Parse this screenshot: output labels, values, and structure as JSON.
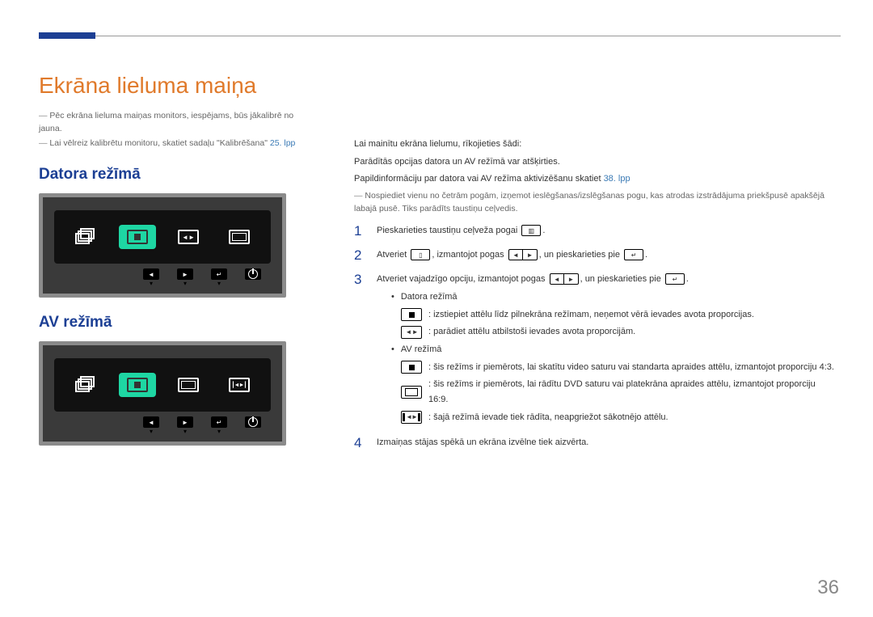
{
  "title": "Ekrāna lieluma maiņa",
  "notes": {
    "n1": "Pēc ekrāna lieluma maiņas monitors, iespējams, būs jākalibrē no jauna.",
    "n2_a": "Lai vēlreiz kalibrētu monitoru, skatiet sadaļu \"Kalibrēšana\" ",
    "n2_link": "25. lpp"
  },
  "left": {
    "h_pc": "Datora režīmā",
    "h_av": "AV režīmā"
  },
  "right": {
    "p1": "Lai mainītu ekrāna lielumu, rīkojieties šādi:",
    "p2": "Parādītās opcijas datora un AV režīmā var atšķirties.",
    "p3_a": "Papildinformāciju par datora vai AV režīma aktivizēšanu skatiet ",
    "p3_link": "38. lpp",
    "note": "Nospiediet vienu no četrām pogām, izņemot ieslēgšanas/izslēgšanas pogu, kas atrodas izstrādājuma priekšpusē apakšējā labajā pusē. Tiks parādīts taustiņu ceļvedis.",
    "steps": {
      "s1": "Pieskarieties taustiņu ceļveža pogai",
      "s2_a": "Atveriet",
      "s2_b": ", izmantojot pogas",
      "s2_c": ", un pieskarieties pie",
      "s3_a": "Atveriet vajadzīgo opciju, izmantojot pogas",
      "s3_b": ", un pieskarieties pie",
      "pc_label": "Datora režīmā",
      "pc_m1": ": izstiepiet attēlu līdz pilnekrāna režīmam, neņemot vērā ievades avota proporcijas.",
      "pc_m2": ": parādiet attēlu atbilstoši ievades avota proporcijām.",
      "av_label": "AV režīmā",
      "av_m1": ": šis režīms ir piemērots, lai skatītu video saturu vai standarta apraides attēlu, izmantojot proporciju 4:3.",
      "av_m2": ": šis režīms ir piemērots, lai rādītu DVD saturu vai platekrāna apraides attēlu, izmantojot proporciju 16:9.",
      "av_m3": ": šajā režīmā ievade tiek rādīta, neapgriežot sākotnējo attēlu.",
      "s4": "Izmaiņas stājas spēkā un ekrāna izvēlne tiek aizvērta."
    }
  },
  "page_number": "36"
}
